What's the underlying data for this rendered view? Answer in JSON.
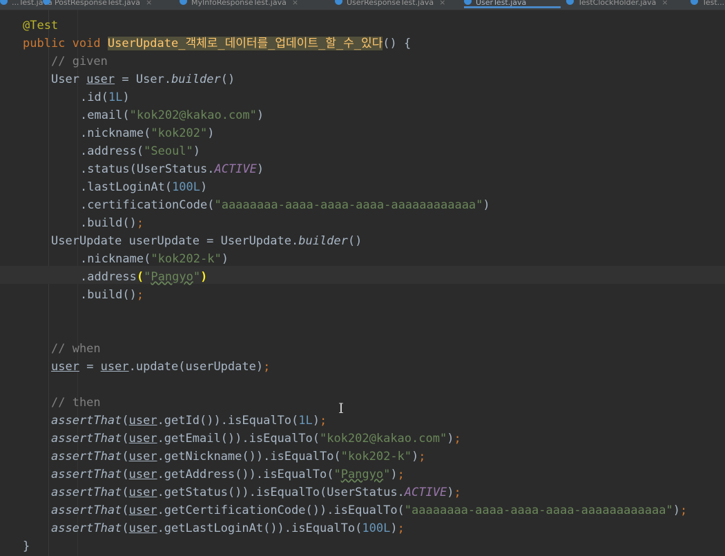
{
  "tabs": [
    {
      "label": "...Test.java"
    },
    {
      "label": "PostResponseTest.java"
    },
    {
      "label": "MyInfoResponseTest.java"
    },
    {
      "label": "UserResponseTest.java"
    },
    {
      "label": "UserTest.java"
    },
    {
      "label": "TestClockHolder.java"
    },
    {
      "label": "Test..."
    }
  ],
  "code": {
    "annotation": "@Test",
    "public_kw": "public",
    "void_kw": "void",
    "method_name": "UserUpdate_객체로_데이터를_업데이트_할_수_있다",
    "sig_tail": "() {",
    "given_comment": "// given",
    "user_type": "User",
    "user_var": "user",
    "eq": " = ",
    "user_class": "User.",
    "builder_call": "builder",
    "parens": "()",
    "id_call": ".id(",
    "id_val": "1L",
    "close_paren": ")",
    "email_call": ".email(",
    "email_val": "\"kok202@kakao.com\"",
    "nickname_call": ".nickname(",
    "nickname_val": "\"kok202\"",
    "address_call": ".address(",
    "address_val": "\"Seoul\"",
    "status_call": ".status(UserStatus.",
    "status_const": "ACTIVE",
    "lastlogin_call": ".lastLoginAt(",
    "lastlogin_val": "100L",
    "cert_call": ".certificationCode(",
    "cert_val": "\"aaaaaaaa-aaaa-aaaa-aaaa-aaaaaaaaaaaa\"",
    "build_call": ".build()",
    "semicolon": ";",
    "uu_decl": "UserUpdate userUpdate = UserUpdate.",
    "uu_nickname_val": "\"kok202-k\"",
    "open_paren": "(",
    "quote": "\"",
    "pangyo": "Pangyo",
    "when_comment": "// when",
    "update_call": ".update(userUpdate)",
    "then_comment": "// then",
    "assert_fn": "assertThat",
    "get_id": ".getId()).isEqualTo(",
    "get_email": ".getEmail()).isEqualTo(",
    "get_nickname": ".getNickname()).isEqualTo(",
    "get_address": ".getAddress()).isEqualTo(",
    "get_status": ".getStatus()).isEqualTo(UserStatus.",
    "get_cert": ".getCertificationCode()).isEqualTo(",
    "get_lastlogin": ".getLastLoginAt()).isEqualTo(",
    "close_brace": "}"
  }
}
